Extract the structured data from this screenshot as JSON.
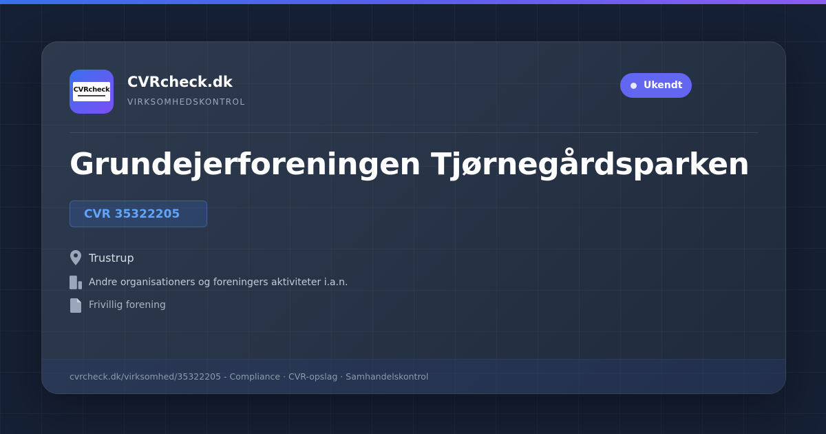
{
  "brand": {
    "logo_text": "CVRcheck",
    "name": "CVRcheck.dk",
    "tagline": "VIRKSOMHEDSKONTROL"
  },
  "status": {
    "label": "Ukendt",
    "color": "#6366f1"
  },
  "company": {
    "name": "Grundejerforeningen Tjørnegårdsparken",
    "cvr": "CVR 35322205",
    "location": "Trustrup",
    "industry": "Andre organisationers og foreningers aktiviteter i.a.n.",
    "company_form": "Frivillig forening"
  },
  "footer": {
    "text": "cvrcheck.dk/virksomhed/35322205 - Compliance · CVR-opslag · Samhandelskontrol"
  },
  "icons": {
    "location": "map-pin-icon",
    "industry": "building-icon",
    "company_form": "document-icon"
  },
  "colors": {
    "accent": "#6366f1",
    "cvr_text": "#60a5fa",
    "background": "#162034"
  }
}
